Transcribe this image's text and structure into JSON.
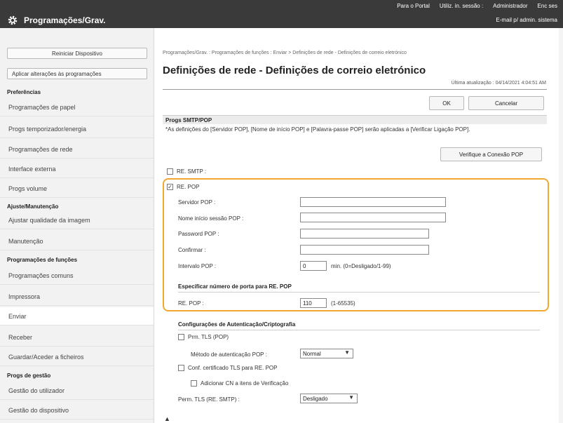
{
  "topbar": {
    "links": [
      "Para o Portal",
      "Utiliz. in. sessão :",
      "Administrador",
      "Enc ses"
    ],
    "app_title": "Programações/Grav.",
    "admin_mail": "E-mail p/ admin. sistema"
  },
  "sidebar": {
    "reset_button": "Reiniciar Dispositivo",
    "apply_button": "Aplicar alterações às programações",
    "categories": {
      "preferences": "Preferências",
      "adjust": "Ajuste/Manutenção",
      "functions": "Programações de funções",
      "management": "Progs de gestão"
    },
    "items": {
      "paper": "Programações de papel",
      "timer": "Progs temporizador/energia",
      "network": "Programações de rede",
      "interface": "Interface externa",
      "volume": "Progs volume",
      "image_quality": "Ajustar qualidade da imagem",
      "maintenance": "Manutenção",
      "common": "Programações comuns",
      "printer": "Impressora",
      "send": "Enviar",
      "receive": "Receber",
      "files": "Guardar/Aceder a ficheiros",
      "user_mgmt": "Gestão do utilizador",
      "device_mgmt": "Gestão do dispositivo"
    }
  },
  "main": {
    "breadcrumb": "Programações/Grav. : Programações de funções : Enviar > Definições de rede - Definições de correio eletrónico",
    "page_title": "Definições de rede - Definições de correio eletrónico",
    "updated": "Última atualização : 04/14/2021 4:04:51 AM",
    "ok_button": "OK",
    "cancel_button": "Cancelar",
    "section_title": "Progs SMTP/POP",
    "note": "*As definições do [Servidor POP], [Nome de início POP] e [Palavra-passe POP] serão aplicadas a [Verificar Ligação POP].",
    "verify_button": "Verifique a Conexão POP",
    "rx_smtp_label": "RE. SMTP :",
    "rx_pop_label": "RE. POP",
    "pop_server_label": "Servidor POP :",
    "pop_login_label": "Nome início sessão POP :",
    "pop_password_label": "Password POP :",
    "confirm_label": "Confirmar :",
    "interval_label": "Intervalo POP :",
    "interval_value": "0",
    "interval_hint": "min. (0=Desligado/1-99)",
    "port_heading": "Especificar número de porta para RE. POP",
    "port_label": "RE. POP :",
    "port_value": "110",
    "port_hint": "(1-65535)",
    "auth_heading": "Configurações de Autenticação/Criptografia",
    "tls_pop_label": "Prm. TLS (POP)",
    "auth_method_label": "Método de autenticação POP :",
    "auth_method_value": "Normal",
    "tls_cert_label": "Conf. certificado TLS para RE. POP",
    "add_cn_label": "Adicionar CN a itens de Verificação",
    "tls_smtp_label": "Perm. TLS (RE. SMTP) :",
    "tls_smtp_value": "Desligado",
    "bottom_mark": "▲"
  },
  "icons": {
    "app": "gear-icon",
    "check": "checkbox-check-icon",
    "dropdown": "chevron-down-icon"
  },
  "colors": {
    "topbar": "#3a3a3a",
    "highlight": "#f0a830",
    "sidebar": "#f2f2f2"
  }
}
